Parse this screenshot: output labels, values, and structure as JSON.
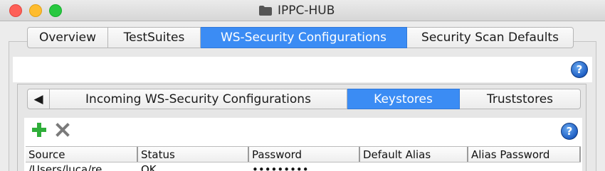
{
  "window": {
    "title": "IPPC-HUB"
  },
  "outer_tabs": [
    {
      "label": "Overview",
      "active": false
    },
    {
      "label": "TestSuites",
      "active": false
    },
    {
      "label": "WS-Security Configurations",
      "active": true
    },
    {
      "label": "Security Scan Defaults",
      "active": false
    }
  ],
  "inner_tabs": {
    "scroll_left": "◀",
    "items": [
      {
        "label": "Incoming WS-Security Configurations",
        "active": false
      },
      {
        "label": "Keystores",
        "active": true
      },
      {
        "label": "Truststores",
        "active": false
      }
    ]
  },
  "help": {
    "glyph": "?"
  },
  "toolbar": {
    "add_icon": "plus-icon",
    "remove_icon": "x-icon"
  },
  "table": {
    "columns": [
      "Source",
      "Status",
      "Password",
      "Default Alias",
      "Alias Password"
    ],
    "rows": [
      [
        "/Users/luca/re",
        "OK",
        "•••••••••",
        "",
        ""
      ]
    ]
  },
  "colors": {
    "accent": "#3b8cf4",
    "add_green": "#2fae3a",
    "remove_gray": "#7a7a7a"
  }
}
